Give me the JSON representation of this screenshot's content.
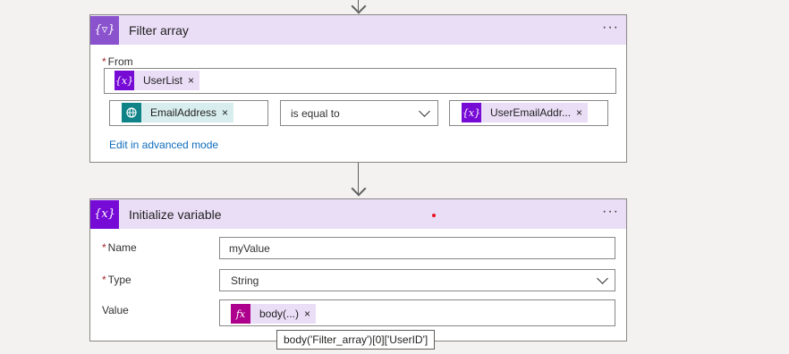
{
  "filter_card": {
    "icon": "filter-variable-icon",
    "title": "Filter array",
    "more": "···",
    "from_label": "From",
    "from_token": {
      "label": "UserList",
      "icon": "variable-icon",
      "remove": "×"
    },
    "left_token": {
      "label": "EmailAddress",
      "icon": "web-globe-icon",
      "remove": "×"
    },
    "operator": "is equal to",
    "right_token": {
      "label": "UserEmailAddr...",
      "icon": "variable-icon",
      "remove": "×"
    },
    "advanced_link": "Edit in advanced mode"
  },
  "init_card": {
    "icon": "variable-icon",
    "title": "Initialize variable",
    "more": "···",
    "name_label": "Name",
    "name_value": "myValue",
    "type_label": "Type",
    "type_value": "String",
    "value_label": "Value",
    "value_token": {
      "label": "body(...)",
      "icon": "fx-icon",
      "remove": "×"
    }
  },
  "tooltip": "body('Filter_array')[0]['UserID']",
  "required_marker": "*",
  "colors": {
    "filter_header": "#eadef7",
    "variable_icon": "#770bd6",
    "teal": "#0f8387",
    "link": "#0f6cbd"
  }
}
